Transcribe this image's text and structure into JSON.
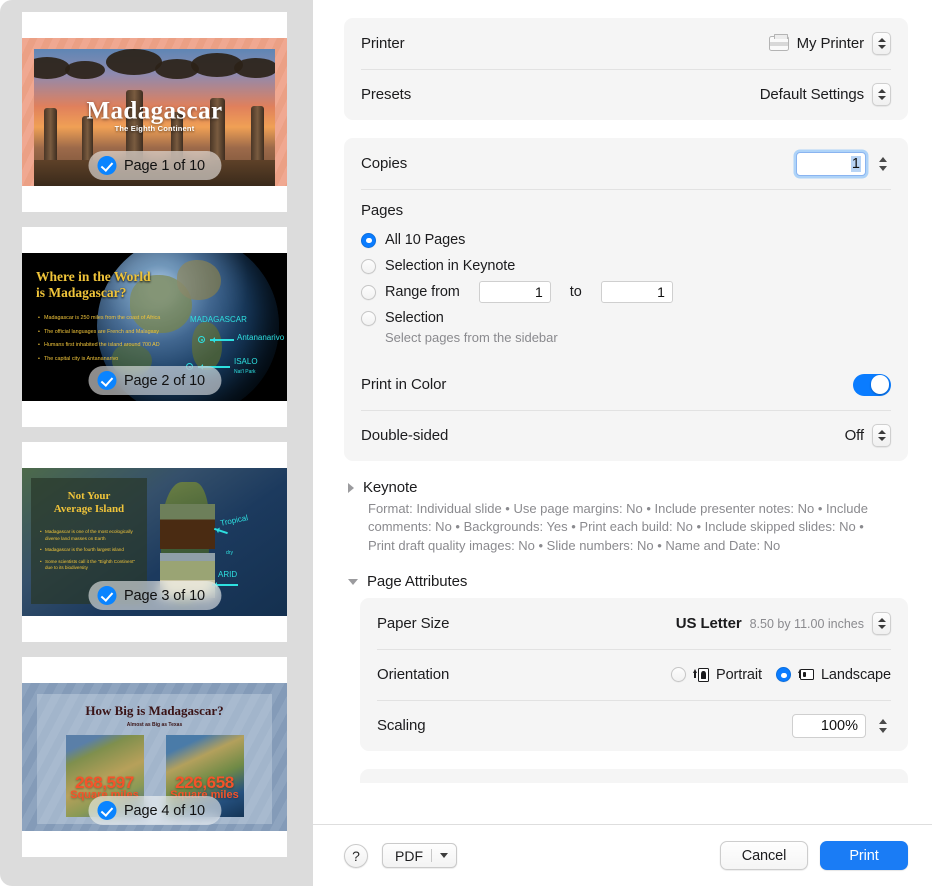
{
  "sidebar": {
    "slides": [
      {
        "badge": "Page 1 of 10",
        "title": "Madagascar",
        "subtitle": "The Eighth Continent"
      },
      {
        "badge": "Page 2 of 10",
        "heading_line1": "Where in the World",
        "heading_line2": "is Madagascar?",
        "bullets": [
          "Madagascar is 250 miles from the coast of Africa",
          "The official languages are French and Malagasy",
          "Humans first inhabited the island around 700 AD",
          "The capital city is Antananarivo"
        ],
        "annotations": {
          "country": "MADAGASCAR",
          "capital": "Antananarivo",
          "park": "ISALO",
          "park_sub": "Nat'l Park"
        }
      },
      {
        "badge": "Page 3 of 10",
        "heading_line1": "Not Your",
        "heading_line2": "Average Island",
        "bullets": [
          "Madagascar is one of the most ecologically diverse land masses on Earth",
          "Madagascar is the fourth largest island",
          "Some scientists call it the \"Eighth Continent\" due to its biodiversity"
        ],
        "annotations": {
          "tropical": "Tropical",
          "arid": "ARID",
          "small": "dry"
        }
      },
      {
        "badge": "Page 4 of 10",
        "title": "How Big is Madagascar?",
        "subtitle": "Almost as Big as Texas",
        "stats": [
          {
            "number": "268,597",
            "unit": "Square miles"
          },
          {
            "number": "226,658",
            "unit": "Square miles"
          }
        ]
      }
    ]
  },
  "main": {
    "printer": {
      "label": "Printer",
      "value": "My Printer",
      "icon": "printer-icon"
    },
    "presets": {
      "label": "Presets",
      "value": "Default Settings"
    },
    "copies": {
      "label": "Copies",
      "value": "1"
    },
    "pages": {
      "label": "Pages",
      "options": [
        {
          "label": "All 10 Pages",
          "selected": true
        },
        {
          "label": "Selection in Keynote",
          "selected": false
        },
        {
          "label": "Range from",
          "selected": false
        },
        {
          "label": "Selection",
          "selected": false
        }
      ],
      "range_from": "1",
      "range_to_label": "to",
      "range_to": "1",
      "hint": "Select pages from the sidebar"
    },
    "print_in_color": {
      "label": "Print in Color",
      "value": "on"
    },
    "double_sided": {
      "label": "Double-sided",
      "value": "Off"
    },
    "keynote_section": {
      "title": "Keynote",
      "expanded": false,
      "summary": "Format: Individual slide • Use page margins: No • Include presenter notes: No • Include comments: No • Backgrounds: Yes • Print each build: No • Include skipped slides: No • Print draft quality images: No • Slide numbers: No • Name and Date: No"
    },
    "page_attributes": {
      "title": "Page Attributes",
      "expanded": true,
      "paper_size": {
        "label": "Paper Size",
        "value": "US Letter",
        "detail": "8.50 by 11.00 inches"
      },
      "orientation": {
        "label": "Orientation",
        "options": [
          {
            "label": "Portrait",
            "selected": false
          },
          {
            "label": "Landscape",
            "selected": true
          }
        ]
      },
      "scaling": {
        "label": "Scaling",
        "value": "100%"
      }
    }
  },
  "bottom_bar": {
    "help": "?",
    "pdf": "PDF",
    "cancel": "Cancel",
    "print": "Print"
  },
  "colors": {
    "accent_blue": "#0a7cff",
    "print_button": "#1a7cf5",
    "card_bg": "#f5f5f5",
    "sidebar_bg": "#dcdcdc"
  }
}
